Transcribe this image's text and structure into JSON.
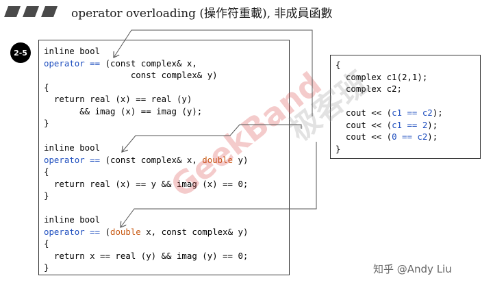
{
  "header": {
    "title": "operator overloading (操作符重載), 非成員函數",
    "section_badge": "2-5"
  },
  "left_code": {
    "overloads": [
      {
        "lines": [
          [
            {
              "t": "inline bool",
              "c": "plain"
            }
          ],
          [
            {
              "t": "operator",
              "c": "kw"
            },
            {
              "t": " ",
              "c": "plain"
            },
            {
              "t": "==",
              "c": "kw"
            },
            {
              "t": " (const complex& x,",
              "c": "plain"
            }
          ],
          [
            {
              "t": "                 const complex& y)",
              "c": "plain"
            }
          ],
          [
            {
              "t": "{",
              "c": "plain"
            }
          ],
          [
            {
              "t": "  return real (x) == real (y)",
              "c": "plain"
            }
          ],
          [
            {
              "t": "       && imag (x) == imag (y);",
              "c": "plain"
            }
          ],
          [
            {
              "t": "}",
              "c": "plain"
            }
          ]
        ]
      },
      {
        "lines": [
          [
            {
              "t": "inline bool",
              "c": "plain"
            }
          ],
          [
            {
              "t": "operator",
              "c": "kw"
            },
            {
              "t": " ",
              "c": "plain"
            },
            {
              "t": "==",
              "c": "kw"
            },
            {
              "t": " (const complex& x, ",
              "c": "plain"
            },
            {
              "t": "double",
              "c": "ty"
            },
            {
              "t": " y)",
              "c": "plain"
            }
          ],
          [
            {
              "t": "{",
              "c": "plain"
            }
          ],
          [
            {
              "t": "  return real (x) == y && imag (x) == 0;",
              "c": "plain"
            }
          ],
          [
            {
              "t": "}",
              "c": "plain"
            }
          ]
        ]
      },
      {
        "lines": [
          [
            {
              "t": "inline bool",
              "c": "plain"
            }
          ],
          [
            {
              "t": "operator",
              "c": "kw"
            },
            {
              "t": " ",
              "c": "plain"
            },
            {
              "t": "==",
              "c": "kw"
            },
            {
              "t": " (",
              "c": "plain"
            },
            {
              "t": "double",
              "c": "ty"
            },
            {
              "t": " x, const complex& y)",
              "c": "plain"
            }
          ],
          [
            {
              "t": "{",
              "c": "plain"
            }
          ],
          [
            {
              "t": "  return x == real (y) && imag (y) == 0;",
              "c": "plain"
            }
          ],
          [
            {
              "t": "}",
              "c": "plain"
            }
          ]
        ]
      }
    ]
  },
  "right_code": {
    "lines": [
      [
        {
          "t": "{",
          "c": "plain"
        }
      ],
      [
        {
          "t": "  complex c1(2,1);",
          "c": "plain"
        }
      ],
      [
        {
          "t": "  complex c2;",
          "c": "plain"
        }
      ],
      [
        {
          "t": "",
          "c": "plain"
        }
      ],
      [
        {
          "t": "  cout << (",
          "c": "plain"
        },
        {
          "t": "c1 == c2",
          "c": "kw"
        },
        {
          "t": ");",
          "c": "plain"
        }
      ],
      [
        {
          "t": "  cout << (",
          "c": "plain"
        },
        {
          "t": "c1 == 2",
          "c": "kw"
        },
        {
          "t": ");",
          "c": "plain"
        }
      ],
      [
        {
          "t": "  cout << (",
          "c": "plain"
        },
        {
          "t": "0 == c2",
          "c": "kw"
        },
        {
          "t": ");",
          "c": "plain"
        }
      ],
      [
        {
          "t": "}",
          "c": "plain"
        }
      ]
    ]
  },
  "watermarks": {
    "brand": "GeekBand",
    "brand_cn": "极客班"
  },
  "credit": "知乎 @Andy Liu",
  "colors": {
    "keyword": "#1f4fbf",
    "type": "#c85a14",
    "bars": "#4a4a4a",
    "arrow": "#555555"
  }
}
